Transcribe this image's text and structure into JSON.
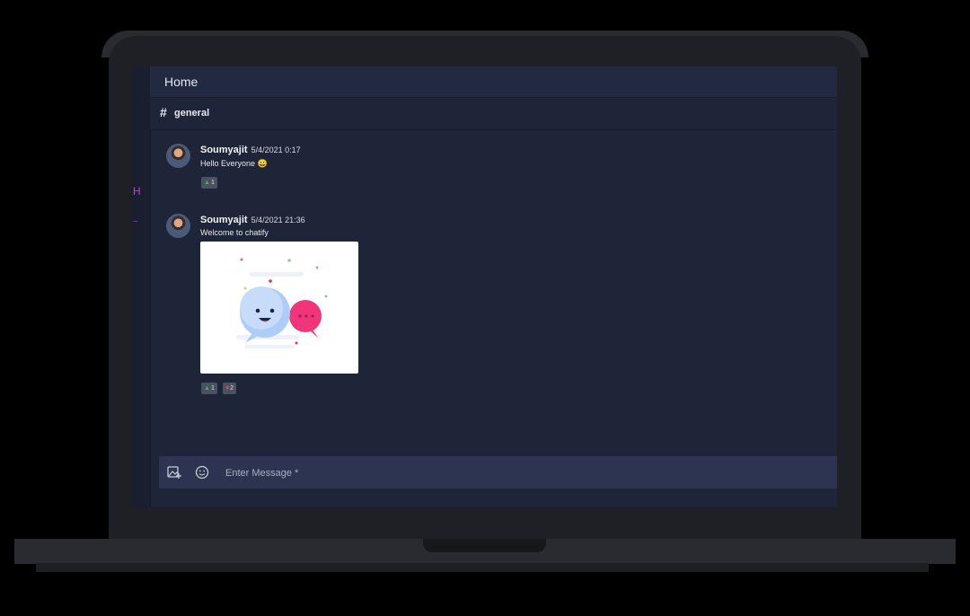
{
  "header": {
    "title": "Home"
  },
  "channel": {
    "hash": "#",
    "name": "general"
  },
  "messages": [
    {
      "author": "Soumyajit",
      "timestamp": "5/4/2021 0:17",
      "text": "Hello Everyone 😀",
      "reactions": [
        {
          "icon": "thumbs-up-icon",
          "count": "1"
        }
      ]
    },
    {
      "author": "Soumyajit",
      "timestamp": "5/4/2021 21:36",
      "text": "Welcome to chatify",
      "attachment": "chat-bubbles-illustration",
      "reactions": [
        {
          "icon": "thumbs-up-icon",
          "count": "1"
        },
        {
          "icon": "heart-icon",
          "count": "2"
        }
      ]
    }
  ],
  "composer": {
    "placeholder": "Enter Message *"
  },
  "colors": {
    "background": "#1f2538",
    "topbar": "#222a41",
    "composer": "#2c3451",
    "accent": "#c43bd8"
  }
}
